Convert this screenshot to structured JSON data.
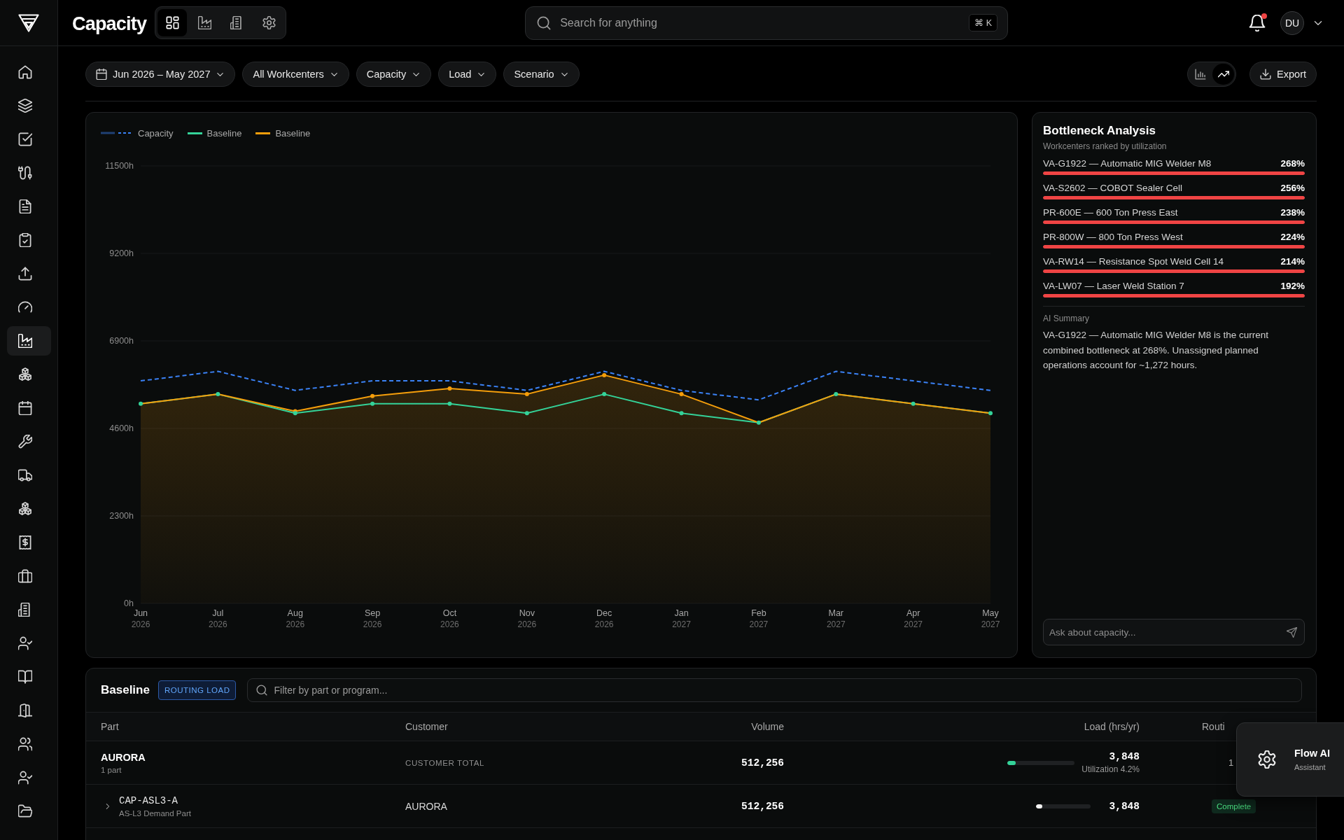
{
  "sidebar": {
    "items": [
      {
        "selected": false
      },
      {
        "selected": false
      },
      {
        "selected": false
      },
      {
        "selected": false
      },
      {
        "selected": false
      },
      {
        "selected": false
      },
      {
        "selected": false
      },
      {
        "selected": false
      },
      {
        "selected": true
      },
      {
        "selected": false
      },
      {
        "selected": false
      },
      {
        "selected": false
      },
      {
        "selected": false
      },
      {
        "selected": false
      },
      {
        "selected": false
      },
      {
        "selected": false
      },
      {
        "selected": false
      },
      {
        "selected": false
      },
      {
        "selected": false
      },
      {
        "selected": false
      },
      {
        "selected": false
      },
      {
        "selected": false
      },
      {
        "selected": false
      }
    ]
  },
  "topbar": {
    "title": "Capacity",
    "views": [
      {
        "selected": true
      },
      {
        "selected": false
      },
      {
        "selected": false
      },
      {
        "selected": false
      }
    ],
    "search": {
      "placeholder": "Search for anything",
      "shortcut": "⌘ K"
    },
    "notifications": {
      "unread": true
    },
    "avatar": {
      "initials": "DU"
    }
  },
  "filters": [
    {
      "kind": "date",
      "label": "Jun 2026 – May 2027"
    },
    {
      "kind": "dropdown",
      "label": "All Workcenters"
    },
    {
      "kind": "dropdown",
      "label": "Capacity"
    },
    {
      "kind": "dropdown",
      "label": "Load"
    },
    {
      "kind": "dropdown",
      "label": "Scenario"
    }
  ],
  "chart_type_toggle": [
    {
      "selected": false
    },
    {
      "selected": true
    }
  ],
  "export_button": "Export",
  "chart": {
    "chart_data": {
      "type": "line",
      "categories": [
        "Jun 2026",
        "Jul 2026",
        "Aug 2026",
        "Sep 2026",
        "Oct 2026",
        "Nov 2026",
        "Dec 2026",
        "Jan 2027",
        "Feb 2027",
        "Mar 2027",
        "Apr 2027",
        "May 2027"
      ],
      "series": [
        {
          "name": "Capacity",
          "color": "#3b82f6",
          "line_style": "dashed",
          "marker": "none",
          "values": [
            5850,
            6100,
            5600,
            5850,
            5850,
            5600,
            6100,
            5600,
            5350,
            6100,
            5850,
            5600
          ]
        },
        {
          "name": "Baseline",
          "color": "#34d399",
          "line_style": "solid",
          "marker": "circle",
          "values": [
            5250,
            5500,
            5000,
            5250,
            5250,
            5000,
            5500,
            5000,
            4750,
            5500,
            5250,
            5000
          ]
        },
        {
          "name": "Baseline",
          "color": "#f59e0b",
          "line_style": "solid",
          "marker": "circle",
          "values": [
            5250,
            5500,
            5050,
            5450,
            5650,
            5500,
            6000,
            5500,
            4750,
            5500,
            5250,
            5000
          ]
        }
      ],
      "ylim": [
        0,
        11500
      ],
      "yticks": [
        {
          "value": 0,
          "label": "0h"
        },
        {
          "value": 2300,
          "label": "2300h"
        },
        {
          "value": 4600,
          "label": "4600h"
        },
        {
          "value": 6900,
          "label": "6900h"
        },
        {
          "value": 9200,
          "label": "9200h"
        },
        {
          "value": 11500,
          "label": "11500h"
        }
      ],
      "grid": true,
      "legend": "upper left"
    }
  },
  "bottleneck": {
    "title": "Bottleneck Analysis",
    "subtitle": "Workcenters ranked by utilization",
    "items": [
      {
        "name": "VA-G1922 — Automatic MIG Welder M8",
        "value": "268%",
        "level": 1
      },
      {
        "name": "VA-S2602 — COBOT Sealer Cell",
        "value": "256%",
        "level": 1
      },
      {
        "name": "PR-600E — 600 Ton Press East",
        "value": "238%",
        "level": 1
      },
      {
        "name": "PR-800W — 800 Ton Press West",
        "value": "224%",
        "level": 1
      },
      {
        "name": "VA-RW14 — Resistance Spot Weld Cell 14",
        "value": "214%",
        "level": 1
      },
      {
        "name": "VA-LW07 — Laser Weld Station 7",
        "value": "192%",
        "level": 1
      }
    ],
    "summary_label": "AI Summary",
    "summary": "VA-G1922 — Automatic MIG Welder M8 is the current combined bottleneck at 268%. Unassigned planned operations account for ~1,272 hours.",
    "ask": {
      "placeholder": "Ask about capacity..."
    }
  },
  "table": {
    "title": "Baseline",
    "badge": "ROUTING LOAD",
    "filter": {
      "placeholder": "Filter by part or program..."
    },
    "columns": [
      "Part",
      "Customer",
      "Volume",
      "Load (hrs/yr)",
      "Routi"
    ],
    "rows": [
      {
        "kind": "group",
        "part": "AURORA",
        "sub": "1 part",
        "customer": "CUSTOMER TOTAL",
        "volume": "512,256",
        "load": "3,848",
        "utilization": "Utilization 4.2%",
        "level": 0.12,
        "routing": "1"
      },
      {
        "kind": "part",
        "expanded": false,
        "part": "CAP-ASL3-A",
        "sub": "AS-L3 Demand Part",
        "customer": "AURORA",
        "volume": "512,256",
        "load": "3,848",
        "level": 0.12,
        "status": "Complete"
      }
    ]
  },
  "assistant": {
    "title": "Flow AI",
    "subtitle": "Assistant"
  }
}
